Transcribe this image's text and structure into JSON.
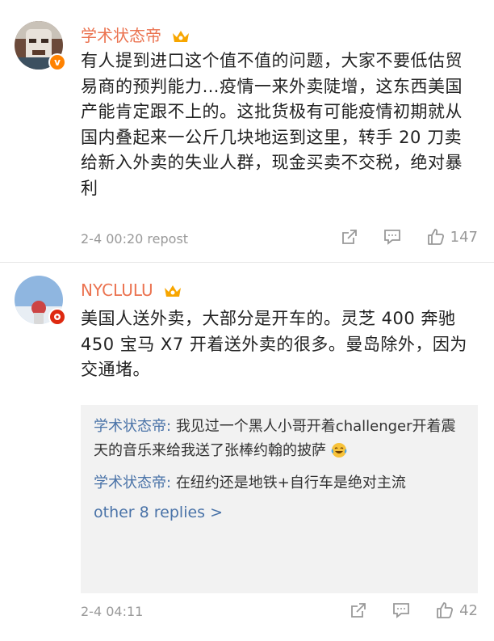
{
  "comments": [
    {
      "username": "学术状态帝",
      "text": "有人提到进口这个值不值的问题，大家不要低估贸易商的预判能力…疫情一来外卖陡增，这东西美国产能肯定跟不上的。这批货极有可能疫情初期就从国内叠起来一公斤几块地运到这里，转手 20 刀卖给新入外卖的失业人群，现金买卖不交税，绝对暴利",
      "time": "2-4 00:20",
      "source": "repost",
      "likes": "147"
    },
    {
      "username": "NYCLULU",
      "text": "美国人送外卖，大部分是开车的。灵芝 400 奔驰 450 宝马 X7 开着送外卖的很多。曼岛除外，因为交通堵。",
      "time": "2-4 04:11",
      "likes": "42",
      "replies": [
        {
          "user": "学术状态帝:",
          "text": "我见过一个黑人小哥开着challenger开着震天的音乐来给我送了张棒约翰的披萨"
        },
        {
          "user": "学术状态帝:",
          "text": "在纽约还是地铁+自行车是绝对主流"
        }
      ],
      "more_replies": "other 8 replies >"
    }
  ],
  "icons": {
    "share": "share-icon",
    "comment": "comment-icon",
    "like": "thumbs-up-icon",
    "crown": "crown-badge-icon",
    "verified": "verified-v-icon",
    "emoji": "laugh-cry-emoji"
  },
  "colors": {
    "username": "#eb7350",
    "reply_user": "#4a73a8",
    "meta": "#999999"
  }
}
